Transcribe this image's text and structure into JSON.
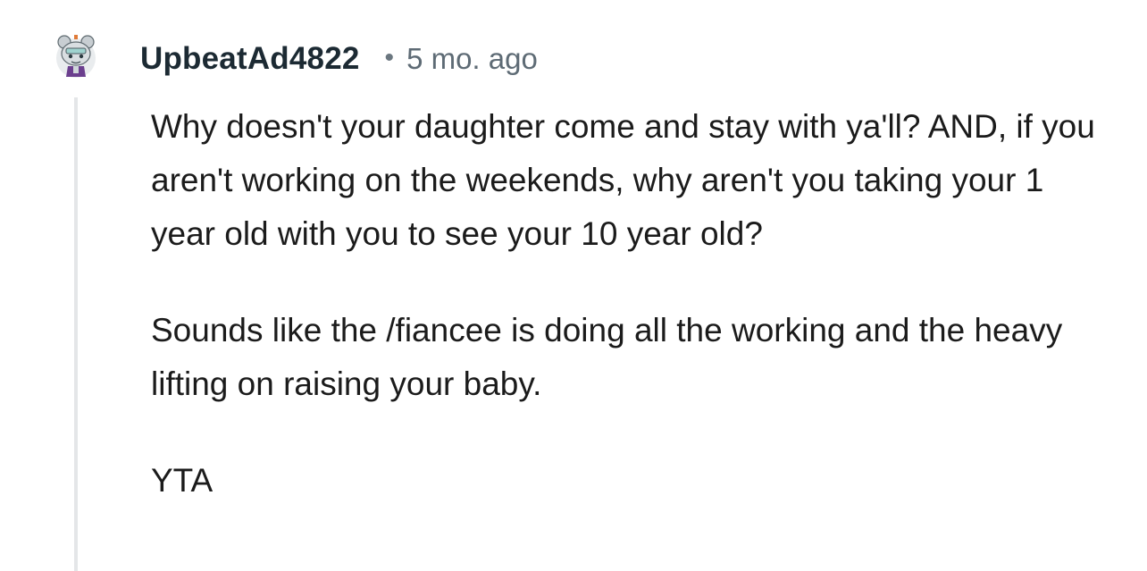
{
  "comment": {
    "username": "UpbeatAd4822",
    "separator": "•",
    "timestamp": "5 mo. ago",
    "avatar_icon": "snoo-avatar-icon",
    "paragraphs": [
      "Why doesn't your daughter come and stay with ya'll? AND, if you aren't working on the weekends, why aren't you taking your 1 year old with you to see your 10 year old?",
      "Sounds like the /fiancee is doing all the working and the heavy lifting on raising your baby.",
      "YTA"
    ]
  }
}
